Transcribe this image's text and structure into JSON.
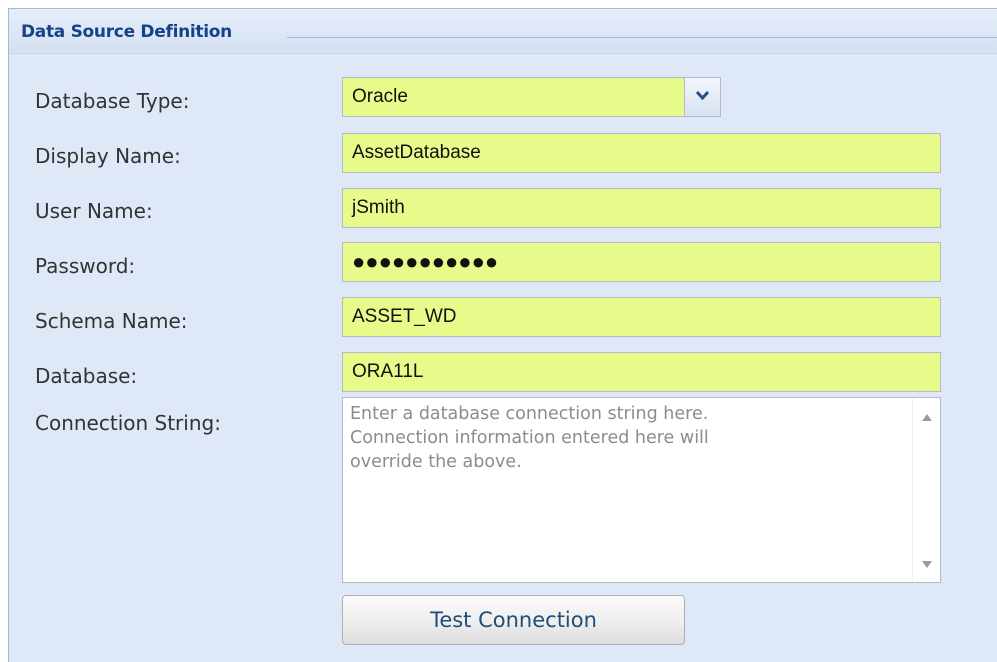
{
  "panel": {
    "title": "Data Source Definition"
  },
  "form": {
    "database_type": {
      "label": "Database Type:",
      "value": "Oracle"
    },
    "display_name": {
      "label": "Display Name:",
      "value": "AssetDatabase"
    },
    "user_name": {
      "label": "User Name:",
      "value": "jSmith"
    },
    "password": {
      "label": "Password:",
      "value": "●●●●●●●●●●●"
    },
    "schema_name": {
      "label": "Schema Name:",
      "value": "ASSET_WD"
    },
    "database": {
      "label": "Database:",
      "value": "ORA11L"
    },
    "connection_string": {
      "label": "Connection String:",
      "placeholder": "Enter a database connection string here.\nConnection information entered here will\noverride the above."
    }
  },
  "actions": {
    "test_connection_label": "Test Connection"
  },
  "colors": {
    "panel_background": "#dfe8f6",
    "field_background": "#e6fb8a",
    "title_color": "#15428b",
    "label_color": "#333333",
    "button_text": "#1f4e79"
  },
  "icons": {
    "dropdown": "chevron-down-icon",
    "scroll_up": "scroll-up-arrow-icon",
    "scroll_down": "scroll-down-arrow-icon"
  }
}
